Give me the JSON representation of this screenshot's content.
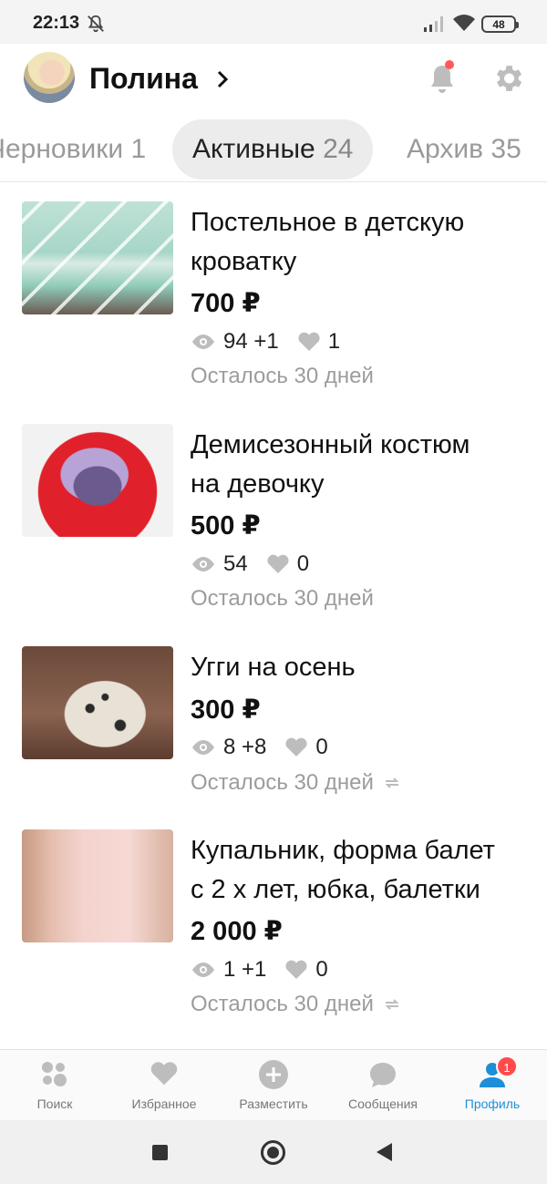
{
  "status_bar": {
    "time": "22:13",
    "battery": "48"
  },
  "header": {
    "user_name": "Полина"
  },
  "tabs": [
    {
      "label": "Черновики",
      "count": "1"
    },
    {
      "label": "Активные",
      "count": "24"
    },
    {
      "label": "Архив",
      "count": "35"
    }
  ],
  "listings": [
    {
      "title_line1": "Постельное в детскую",
      "title_line2": "кроватку",
      "price": "700 ₽",
      "views": "94 +1",
      "likes": "1",
      "remaining": "Осталось 30 дней",
      "renewed": false
    },
    {
      "title_line1": "Демисезонный костюм",
      "title_line2": "на девочку",
      "price": "500 ₽",
      "views": "54",
      "likes": "0",
      "remaining": "Осталось 30 дней",
      "renewed": false
    },
    {
      "title_line1": "Угги на осень",
      "title_line2": "",
      "price": "300 ₽",
      "views": "8 +8",
      "likes": "0",
      "remaining": "Осталось 30 дней",
      "renewed": true
    },
    {
      "title_line1": "Купальник, форма балет",
      "title_line2": "с 2 х лет, юбка, балетки",
      "price": "2 000 ₽",
      "views": "1 +1",
      "likes": "0",
      "remaining": "Осталось 30 дней",
      "renewed": true
    }
  ],
  "bottom_nav": {
    "search": "Поиск",
    "favorites": "Избранное",
    "post": "Разместить",
    "messages": "Сообщения",
    "profile": "Профиль",
    "profile_badge": "1"
  },
  "colors": {
    "accent": "#1d8fd8",
    "badge": "#ff4b4b",
    "notification_dot": "#ff5a5a"
  }
}
